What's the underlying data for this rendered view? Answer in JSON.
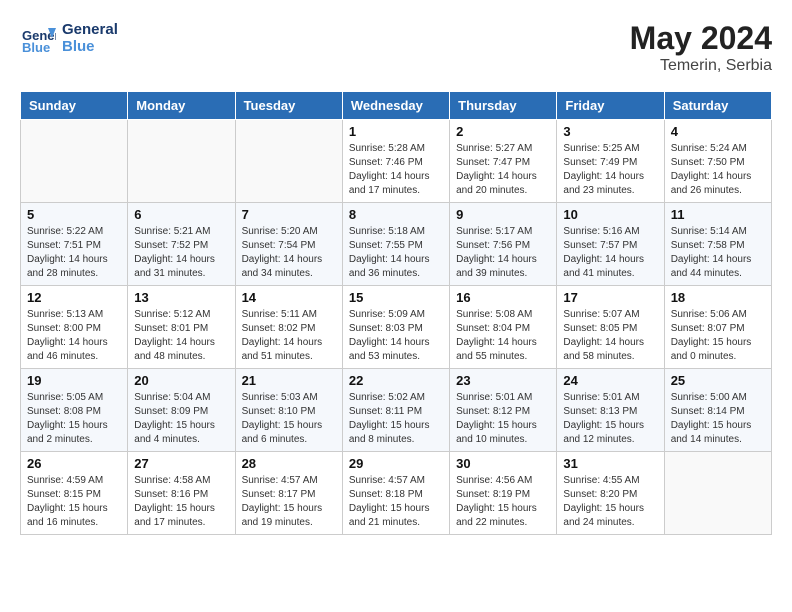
{
  "header": {
    "logo_line1": "General",
    "logo_line2": "Blue",
    "month_year": "May 2024",
    "location": "Temerin, Serbia"
  },
  "weekdays": [
    "Sunday",
    "Monday",
    "Tuesday",
    "Wednesday",
    "Thursday",
    "Friday",
    "Saturday"
  ],
  "weeks": [
    [
      {
        "day": "",
        "info": ""
      },
      {
        "day": "",
        "info": ""
      },
      {
        "day": "",
        "info": ""
      },
      {
        "day": "1",
        "info": "Sunrise: 5:28 AM\nSunset: 7:46 PM\nDaylight: 14 hours\nand 17 minutes."
      },
      {
        "day": "2",
        "info": "Sunrise: 5:27 AM\nSunset: 7:47 PM\nDaylight: 14 hours\nand 20 minutes."
      },
      {
        "day": "3",
        "info": "Sunrise: 5:25 AM\nSunset: 7:49 PM\nDaylight: 14 hours\nand 23 minutes."
      },
      {
        "day": "4",
        "info": "Sunrise: 5:24 AM\nSunset: 7:50 PM\nDaylight: 14 hours\nand 26 minutes."
      }
    ],
    [
      {
        "day": "5",
        "info": "Sunrise: 5:22 AM\nSunset: 7:51 PM\nDaylight: 14 hours\nand 28 minutes."
      },
      {
        "day": "6",
        "info": "Sunrise: 5:21 AM\nSunset: 7:52 PM\nDaylight: 14 hours\nand 31 minutes."
      },
      {
        "day": "7",
        "info": "Sunrise: 5:20 AM\nSunset: 7:54 PM\nDaylight: 14 hours\nand 34 minutes."
      },
      {
        "day": "8",
        "info": "Sunrise: 5:18 AM\nSunset: 7:55 PM\nDaylight: 14 hours\nand 36 minutes."
      },
      {
        "day": "9",
        "info": "Sunrise: 5:17 AM\nSunset: 7:56 PM\nDaylight: 14 hours\nand 39 minutes."
      },
      {
        "day": "10",
        "info": "Sunrise: 5:16 AM\nSunset: 7:57 PM\nDaylight: 14 hours\nand 41 minutes."
      },
      {
        "day": "11",
        "info": "Sunrise: 5:14 AM\nSunset: 7:58 PM\nDaylight: 14 hours\nand 44 minutes."
      }
    ],
    [
      {
        "day": "12",
        "info": "Sunrise: 5:13 AM\nSunset: 8:00 PM\nDaylight: 14 hours\nand 46 minutes."
      },
      {
        "day": "13",
        "info": "Sunrise: 5:12 AM\nSunset: 8:01 PM\nDaylight: 14 hours\nand 48 minutes."
      },
      {
        "day": "14",
        "info": "Sunrise: 5:11 AM\nSunset: 8:02 PM\nDaylight: 14 hours\nand 51 minutes."
      },
      {
        "day": "15",
        "info": "Sunrise: 5:09 AM\nSunset: 8:03 PM\nDaylight: 14 hours\nand 53 minutes."
      },
      {
        "day": "16",
        "info": "Sunrise: 5:08 AM\nSunset: 8:04 PM\nDaylight: 14 hours\nand 55 minutes."
      },
      {
        "day": "17",
        "info": "Sunrise: 5:07 AM\nSunset: 8:05 PM\nDaylight: 14 hours\nand 58 minutes."
      },
      {
        "day": "18",
        "info": "Sunrise: 5:06 AM\nSunset: 8:07 PM\nDaylight: 15 hours\nand 0 minutes."
      }
    ],
    [
      {
        "day": "19",
        "info": "Sunrise: 5:05 AM\nSunset: 8:08 PM\nDaylight: 15 hours\nand 2 minutes."
      },
      {
        "day": "20",
        "info": "Sunrise: 5:04 AM\nSunset: 8:09 PM\nDaylight: 15 hours\nand 4 minutes."
      },
      {
        "day": "21",
        "info": "Sunrise: 5:03 AM\nSunset: 8:10 PM\nDaylight: 15 hours\nand 6 minutes."
      },
      {
        "day": "22",
        "info": "Sunrise: 5:02 AM\nSunset: 8:11 PM\nDaylight: 15 hours\nand 8 minutes."
      },
      {
        "day": "23",
        "info": "Sunrise: 5:01 AM\nSunset: 8:12 PM\nDaylight: 15 hours\nand 10 minutes."
      },
      {
        "day": "24",
        "info": "Sunrise: 5:01 AM\nSunset: 8:13 PM\nDaylight: 15 hours\nand 12 minutes."
      },
      {
        "day": "25",
        "info": "Sunrise: 5:00 AM\nSunset: 8:14 PM\nDaylight: 15 hours\nand 14 minutes."
      }
    ],
    [
      {
        "day": "26",
        "info": "Sunrise: 4:59 AM\nSunset: 8:15 PM\nDaylight: 15 hours\nand 16 minutes."
      },
      {
        "day": "27",
        "info": "Sunrise: 4:58 AM\nSunset: 8:16 PM\nDaylight: 15 hours\nand 17 minutes."
      },
      {
        "day": "28",
        "info": "Sunrise: 4:57 AM\nSunset: 8:17 PM\nDaylight: 15 hours\nand 19 minutes."
      },
      {
        "day": "29",
        "info": "Sunrise: 4:57 AM\nSunset: 8:18 PM\nDaylight: 15 hours\nand 21 minutes."
      },
      {
        "day": "30",
        "info": "Sunrise: 4:56 AM\nSunset: 8:19 PM\nDaylight: 15 hours\nand 22 minutes."
      },
      {
        "day": "31",
        "info": "Sunrise: 4:55 AM\nSunset: 8:20 PM\nDaylight: 15 hours\nand 24 minutes."
      },
      {
        "day": "",
        "info": ""
      }
    ]
  ]
}
